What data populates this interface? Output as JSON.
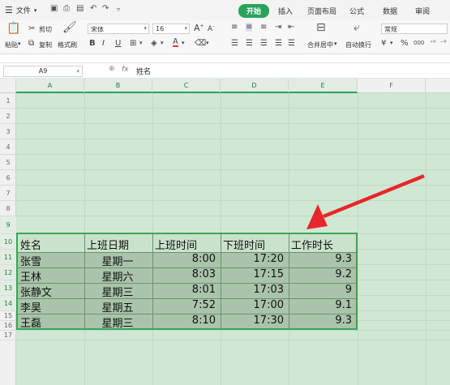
{
  "menu": {
    "file_label": "文件",
    "tabs": [
      {
        "label": "开始",
        "active": true
      },
      {
        "label": "插入"
      },
      {
        "label": "页面布局"
      },
      {
        "label": "公式"
      },
      {
        "label": "数据"
      },
      {
        "label": "审阅"
      }
    ]
  },
  "ribbon": {
    "paste_label": "粘贴",
    "cut_label": "剪切",
    "copy_label": "复制",
    "format_painter_label": "格式刷",
    "font_name": "宋体",
    "font_size": "16",
    "bold": "B",
    "italic": "I",
    "underline": "U",
    "font_color_glyph": "A",
    "merge_label": "合并居中",
    "wrap_label": "自动换行",
    "number_format": "常规",
    "percent": "%",
    "thousands": "000"
  },
  "formula_bar": {
    "name_box": "A9",
    "fx": "fx",
    "content": "姓名"
  },
  "sheet": {
    "columns": [
      "A",
      "B",
      "C",
      "D",
      "E",
      "F"
    ],
    "rows": [
      "1",
      "2",
      "3",
      "4",
      "5",
      "6",
      "7",
      "8",
      "9",
      "10",
      "11",
      "12",
      "13",
      "14",
      "15",
      "16",
      "17"
    ],
    "headers": [
      "姓名",
      "上班日期",
      "上班时间",
      "下班时间",
      "工作时长"
    ],
    "data": [
      [
        "张雪",
        "星期一",
        "8:00",
        "17:20",
        "9.3"
      ],
      [
        "王林",
        "星期六",
        "8:03",
        "17:15",
        "9.2"
      ],
      [
        "张静文",
        "星期三",
        "8:01",
        "17:03",
        "9"
      ],
      [
        "李昊",
        "星期五",
        "7:52",
        "17:00",
        "9.1"
      ],
      [
        "王磊",
        "星期三",
        "8:10",
        "17:30",
        "9.3"
      ]
    ]
  },
  "colors": {
    "accent": "#2aa35a",
    "selection": "#cfe8d3",
    "arrow": "#e8262b"
  }
}
